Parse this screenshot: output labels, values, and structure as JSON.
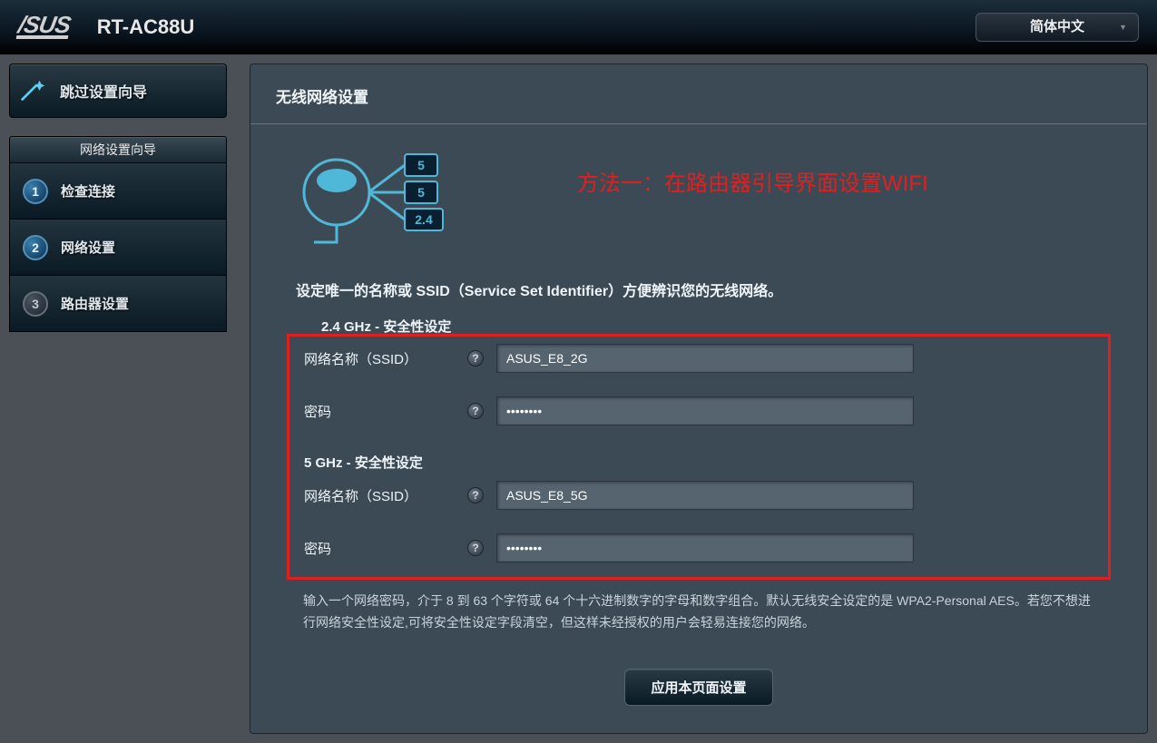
{
  "header": {
    "brand": "/SUS",
    "model": "RT-AC88U",
    "language": "简体中文"
  },
  "sidebar": {
    "skip_label": "跳过设置向导",
    "wizard_title": "网络设置向导",
    "steps": [
      {
        "num": "1",
        "label": "检查连接",
        "active": true
      },
      {
        "num": "2",
        "label": "网络设置",
        "active": true
      },
      {
        "num": "3",
        "label": "路由器设置",
        "active": false
      }
    ]
  },
  "page": {
    "title": "无线网络设置",
    "instruction": "设定唯一的名称或 SSID（Service Set Identifier）方便辨识您的无线网络。",
    "section_24": "2.4 GHz - 安全性设定",
    "section_5": "5 GHz - 安全性设定",
    "ssid_label": "网络名称（SSID）",
    "pwd_label": "密码",
    "ssid_24_value": "ASUS_E8_2G",
    "pwd_24_value": "••••••••",
    "ssid_5_value": "ASUS_E8_5G",
    "pwd_5_value": "••••••••",
    "note": "输入一个网络密码，介于 8 到 63 个字符或 64 个十六进制数字的字母和数字组合。默认无线安全设定的是 WPA2-Personal AES。若您不想进行网络安全性设定,可将安全性设定字段清空，但这样未经授权的用户会轻易连接您的网络。",
    "apply": "应用本页面设置",
    "graphic_bands": [
      "5",
      "5",
      "2.4"
    ]
  },
  "annotation": {
    "text": "方法一：在路由器引导界面设置WIFI"
  }
}
